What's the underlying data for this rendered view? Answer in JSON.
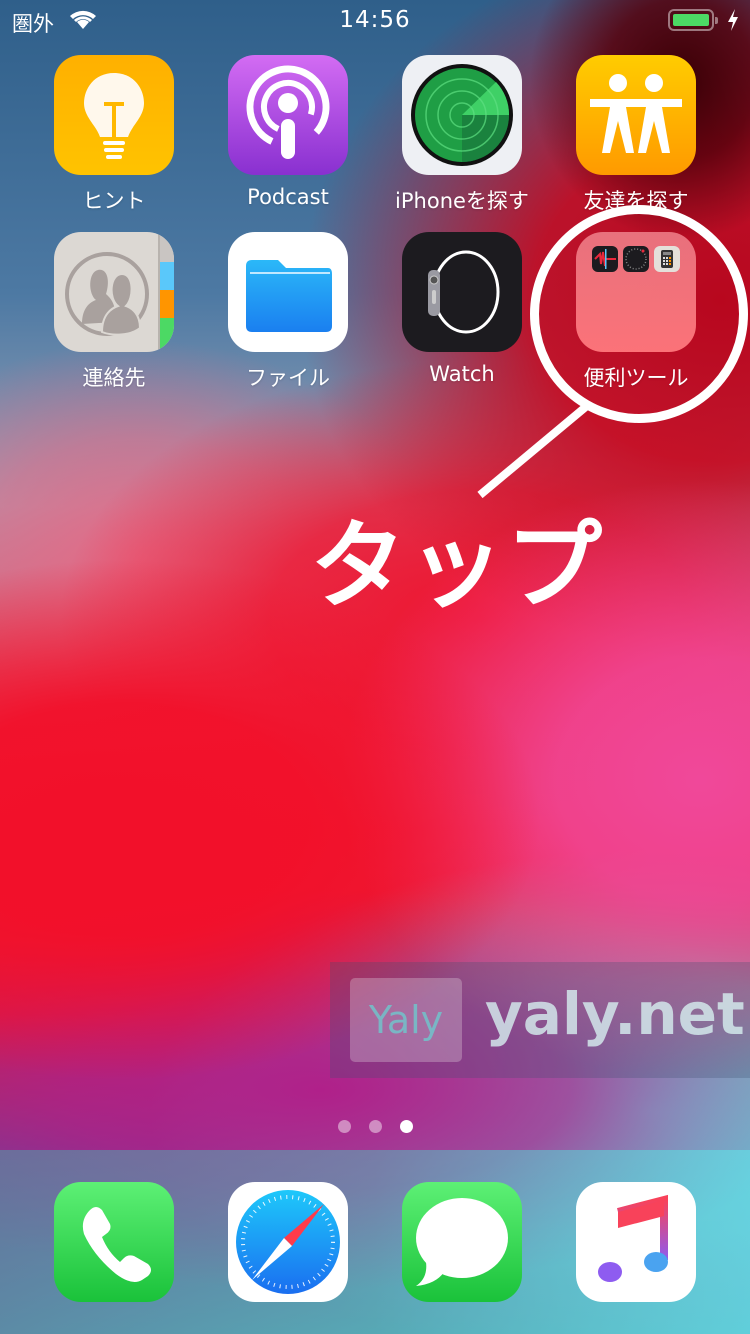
{
  "status_bar": {
    "carrier": "圏外",
    "time": "14:56",
    "battery_level": 1.0,
    "charging": true
  },
  "home_apps": [
    {
      "label": "ヒント",
      "icon": "lightbulb-icon"
    },
    {
      "label": "Podcast",
      "icon": "podcast-icon"
    },
    {
      "label": "iPhoneを探す",
      "icon": "radar-icon"
    },
    {
      "label": "友達を探す",
      "icon": "friends-icon"
    },
    {
      "label": "連絡先",
      "icon": "contacts-icon"
    },
    {
      "label": "ファイル",
      "icon": "folder-file-icon"
    },
    {
      "label": "Watch",
      "icon": "watch-icon"
    },
    {
      "label": "便利ツール",
      "icon": "app-folder-icon"
    }
  ],
  "folder_contents": [
    "voice-memos-icon",
    "compass-icon",
    "calculator-icon"
  ],
  "annotation": {
    "text": "タップ",
    "color": "#ffffff"
  },
  "watermark": {
    "logo": "Yaly",
    "site": "yaly.net"
  },
  "page_indicator": {
    "count": 3,
    "current": 3
  },
  "dock": [
    {
      "name": "phone",
      "icon": "phone-icon"
    },
    {
      "name": "safari",
      "icon": "safari-icon"
    },
    {
      "name": "messages",
      "icon": "messages-icon"
    },
    {
      "name": "music",
      "icon": "music-icon"
    }
  ],
  "colors": {
    "battery": "#4cd964",
    "wallpaper_red": "#ee1d33"
  }
}
